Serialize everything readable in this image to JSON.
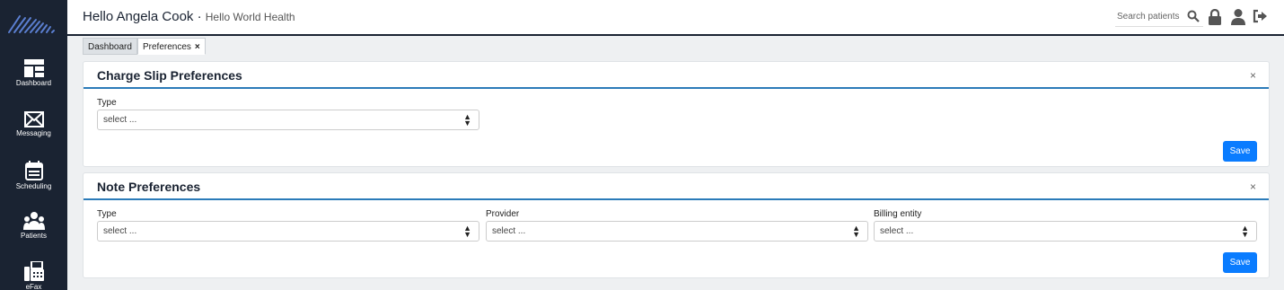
{
  "header": {
    "greeting": "Hello Angela Cook",
    "separator": " · ",
    "org": "Hello World Health",
    "search_placeholder": "Search patients"
  },
  "icons": {
    "logo": "logo-icon",
    "search": "search-icon",
    "lock": "lock-icon",
    "user": "user-icon",
    "logout": "logout-icon"
  },
  "sidebar": {
    "items": [
      {
        "label": "Dashboard",
        "icon": "dashboard-icon"
      },
      {
        "label": "Messaging",
        "icon": "envelope-icon"
      },
      {
        "label": "Scheduling",
        "icon": "calendar-icon"
      },
      {
        "label": "Patients",
        "icon": "users-icon"
      },
      {
        "label": "eFax",
        "icon": "fax-icon"
      }
    ]
  },
  "tabs": [
    {
      "label": "Dashboard"
    },
    {
      "label": "Preferences",
      "close": "×"
    }
  ],
  "charge_slip": {
    "title": "Charge Slip Preferences",
    "close": "×",
    "type_label": "Type",
    "type_value": "select ...",
    "save": "Save"
  },
  "note": {
    "title": "Note Preferences",
    "close": "×",
    "type_label": "Type",
    "type_value": "select ...",
    "provider_label": "Provider",
    "provider_value": "select ...",
    "billing_label": "Billing entity",
    "billing_value": "select ...",
    "save": "Save"
  },
  "colors": {
    "sidebar": "#1a2332",
    "accent": "#2b7bb9",
    "button": "#0a7cff"
  }
}
